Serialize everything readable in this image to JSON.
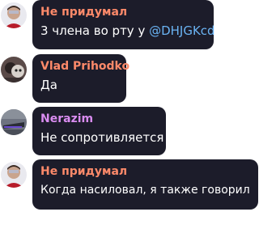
{
  "messages": [
    {
      "author": "Не придумал",
      "author_color": "#ff8a6a",
      "text": "3 члена во рту у ",
      "mention": "@DHJGKcd"
    },
    {
      "author": "Vlad Prihodko",
      "author_color": "#ff8a6a",
      "text": "Да"
    },
    {
      "author": "Nerazim",
      "author_color": "#d98cf0",
      "text": "Не сопротивляется"
    },
    {
      "author": "Не придумал",
      "author_color": "#ff8a6a",
      "text": "Когда насиловал, я также говорил"
    }
  ],
  "colors": {
    "bubble": "#1c1c2a",
    "text": "#ffffff",
    "mention": "#6ab3f3"
  },
  "icons": [
    "avatar-photo-icon"
  ]
}
